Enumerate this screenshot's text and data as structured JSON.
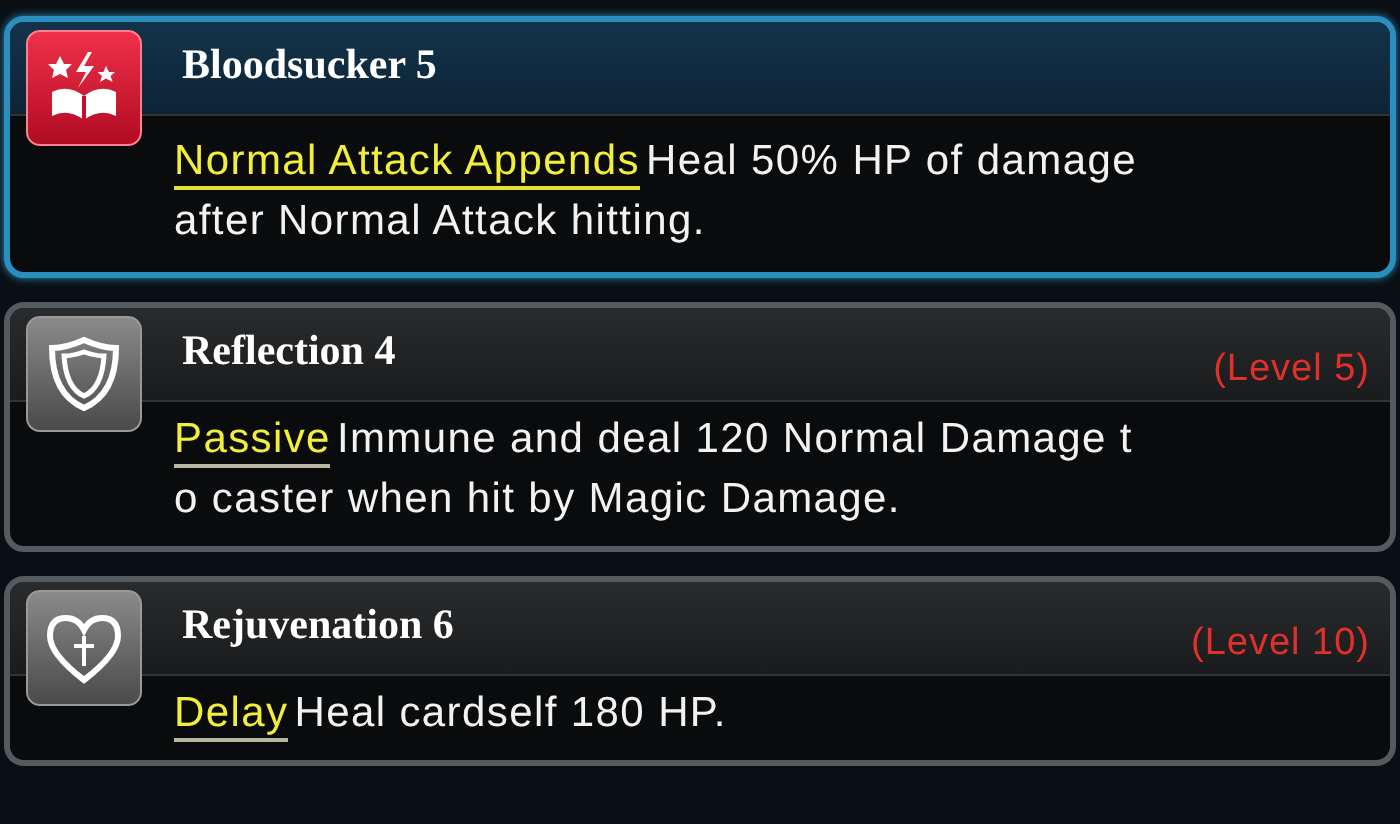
{
  "skills": [
    {
      "name": "Bloodsucker 5",
      "selected": true,
      "tag": "Normal Attack Appends",
      "lines": [
        "Heal 50% HP of damage",
        "after Normal Attack hitting."
      ]
    },
    {
      "name": "Reflection 4",
      "selected": false,
      "level": "(Level 5)",
      "tag": "Passive",
      "lines": [
        "Immune and deal 120 Normal Damage t",
        "o caster when hit by Magic Damage."
      ]
    },
    {
      "name": "Rejuvenation 6",
      "selected": false,
      "level": "(Level 10)",
      "tag": "Delay",
      "lines": [
        "Heal cardself 180 HP."
      ]
    }
  ]
}
